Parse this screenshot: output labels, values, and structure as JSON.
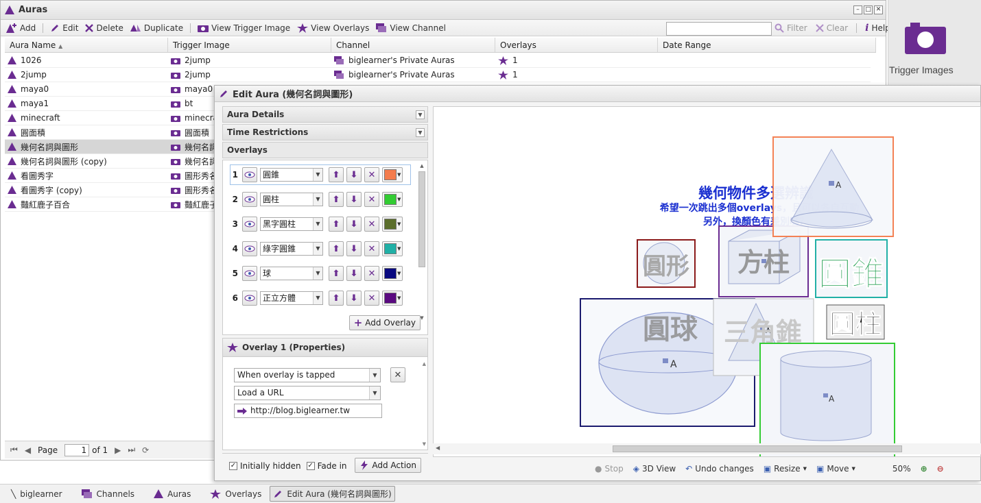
{
  "auras_window": {
    "title": "Auras"
  },
  "toolbar": {
    "add": "Add",
    "edit": "Edit",
    "delete": "Delete",
    "duplicate": "Duplicate",
    "view_trigger": "View Trigger Image",
    "view_overlays": "View Overlays",
    "view_channel": "View Channel",
    "filter": "Filter",
    "clear": "Clear",
    "help": "Help",
    "filter_value": ""
  },
  "grid": {
    "columns": [
      "Aura Name",
      "Trigger Image",
      "Channel",
      "Overlays",
      "Date Range"
    ],
    "rows": [
      {
        "name": "1026",
        "trigger": "2jump",
        "channel": "biglearner's Private Auras",
        "overlays": "1"
      },
      {
        "name": "2jump",
        "trigger": "2jump",
        "channel": "biglearner's Private Auras",
        "overlays": "1"
      },
      {
        "name": "maya0",
        "trigger": "maya0",
        "channel": "",
        "overlays": ""
      },
      {
        "name": "maya1",
        "trigger": "bt",
        "channel": "",
        "overlays": ""
      },
      {
        "name": "minecraft",
        "trigger": "minecrat",
        "channel": "",
        "overlays": ""
      },
      {
        "name": "圓面積",
        "trigger": "圓面積",
        "channel": "",
        "overlays": ""
      },
      {
        "name": "幾何名詞與圖形",
        "trigger": "幾何名詞",
        "channel": "",
        "overlays": ""
      },
      {
        "name": "幾何名詞與圖形 (copy)",
        "trigger": "幾何名詞",
        "channel": "",
        "overlays": ""
      },
      {
        "name": "看圖秀字",
        "trigger": "圖形秀名",
        "channel": "",
        "overlays": ""
      },
      {
        "name": "看圖秀字 (copy)",
        "trigger": "圖形秀名",
        "channel": "",
        "overlays": ""
      },
      {
        "name": "豔紅鹿子百合",
        "trigger": "豔紅鹿子",
        "channel": "",
        "overlays": ""
      }
    ]
  },
  "pager": {
    "page_label": "Page",
    "page_value": "1",
    "of_label": "of 1"
  },
  "trigger_panel": {
    "label": "Trigger Images"
  },
  "edit_window": {
    "title": "Edit Aura (幾何名詞與圖形)"
  },
  "accordion": {
    "details": "Aura Details",
    "time": "Time Restrictions",
    "overlays": "Overlays"
  },
  "overlays": [
    {
      "num": "1",
      "name": "圓錐",
      "color": "#f47c4c"
    },
    {
      "num": "2",
      "name": "圓柱",
      "color": "#33cc33"
    },
    {
      "num": "3",
      "name": "黑字圓柱",
      "color": "#5b6e2c"
    },
    {
      "num": "4",
      "name": "綠字圓錐",
      "color": "#21b0a6"
    },
    {
      "num": "5",
      "name": "球",
      "color": "#0a0a80"
    },
    {
      "num": "6",
      "name": "正立方體",
      "color": "#5a0a80"
    }
  ],
  "add_overlay": "Add Overlay",
  "props": {
    "title": "Overlay 1 (Properties)",
    "trigger": "When overlay is tapped",
    "action": "Load a URL",
    "url": "http://blog.biglearner.tw",
    "initially_hidden": "Initially hidden",
    "fade_in": "Fade in",
    "add_action": "Add Action"
  },
  "canvas": {
    "heading": "幾何物件多選辨識",
    "line1": "希望一次跳出多個overlays，且可以各自互動",
    "line2": "另外，換顏色有差別嗎？",
    "shape_labels": {
      "circle": "圓形",
      "prism": "方柱",
      "cone_green": "圓錐",
      "sphere": "圓球",
      "pyramid": "三角錐",
      "cylinder_black": "圓柱"
    },
    "anchor": "A"
  },
  "canvas_bar": {
    "stop": "Stop",
    "view3d": "3D View",
    "undo": "Undo changes",
    "resize": "Resize",
    "move": "Move",
    "zoom": "50%"
  },
  "taskbar": {
    "user": "biglearner",
    "channels": "Channels",
    "auras": "Auras",
    "overlays": "Overlays",
    "edit": "Edit Aura (幾何名詞與圖形)"
  },
  "colors": {
    "accent": "#6a2c91",
    "selection": "#d6d6d6"
  }
}
